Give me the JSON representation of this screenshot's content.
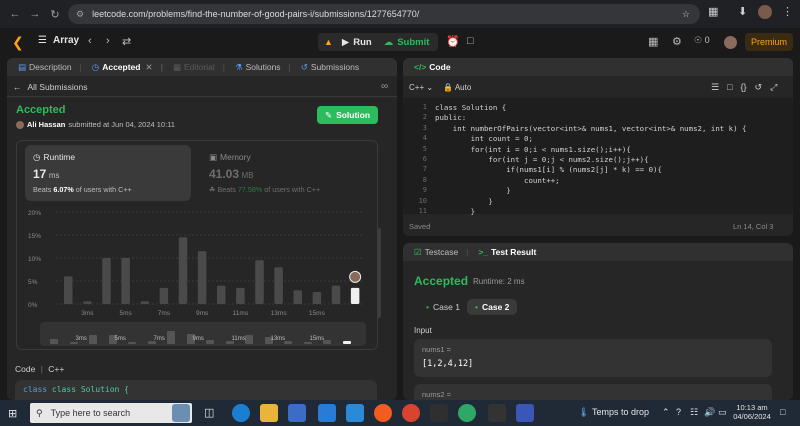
{
  "browser": {
    "url": "leetcode.com/problems/find-the-number-of-good-pairs-i/submissions/1277654770/"
  },
  "header": {
    "problem_list": "Array",
    "run_label": "Run",
    "submit_label": "Submit",
    "streak_count": "0",
    "premium_label": "Premium"
  },
  "left": {
    "tabs": [
      {
        "label": "Description"
      },
      {
        "label": "Accepted"
      },
      {
        "label": "Editorial"
      },
      {
        "label": "Solutions"
      },
      {
        "label": "Submissions"
      }
    ],
    "back_label": "All Submissions",
    "status": "Accepted",
    "author": "Ali Hassan",
    "submitted_text": "submitted at Jun 04, 2024 10:11",
    "solution_btn": "Solution",
    "runtime": {
      "title": "Runtime",
      "value": "17",
      "unit": "ms",
      "beats_prefix": "Beats",
      "beats_pct": "6.07%",
      "beats_suffix": "of users with C++"
    },
    "memory": {
      "title": "Memory",
      "value": "41.03",
      "unit": "MB",
      "beats_prefix": "Beats",
      "beats_pct": "77.58%",
      "beats_suffix": "of users with C++"
    },
    "code_label": "Code",
    "code_lang": "C++",
    "code_preview": "class Solution {"
  },
  "chart_data": {
    "type": "bar",
    "yticks": [
      "20%",
      "15%",
      "10%",
      "5%",
      "0%"
    ],
    "ylim": [
      0,
      20
    ],
    "x_tick_labels": [
      "3ms",
      "5ms",
      "7ms",
      "9ms",
      "11ms",
      "13ms",
      "15ms"
    ],
    "values": [
      6,
      0.6,
      10,
      10,
      0.6,
      3.5,
      14.5,
      11.5,
      4,
      3.5,
      9.5,
      8,
      3,
      2.6,
      4,
      3.5
    ],
    "highlight_index": 15
  },
  "code": {
    "title": "Code",
    "lang": "C++",
    "auto_label": "Auto",
    "line_numbers": [
      "1",
      "2",
      "3",
      "4",
      "5",
      "6",
      "7",
      "8",
      "9",
      "10",
      "11"
    ],
    "lines": [
      "class Solution {",
      "public:",
      "    int numberOfPairs(vector<int>& nums1, vector<int>& nums2, int k) {",
      "        int count = 0;",
      "        for(int i = 0;i < nums1.size();i++){",
      "            for(int j = 0;j < nums2.size();j++){",
      "                if(nums1[i] % (nums2[j] * k) == 0){",
      "                    count++;",
      "                }",
      "            }",
      "        }"
    ],
    "saved_label": "Saved",
    "cursor_pos": "Ln 14, Col 3"
  },
  "test": {
    "testcase_tab": "Testcase",
    "result_tab": "Test Result",
    "status": "Accepted",
    "runtime_text": "Runtime: 2 ms",
    "cases": [
      "Case 1",
      "Case 2"
    ],
    "input_label": "Input",
    "var1_name": "nums1 =",
    "var1_value": "[1,2,4,12]",
    "var2_name": "nums2 ="
  },
  "taskbar": {
    "search_placeholder": "Type here to search",
    "weather": "Temps to drop",
    "time": "10:13 am",
    "date": "04/06/2024"
  }
}
